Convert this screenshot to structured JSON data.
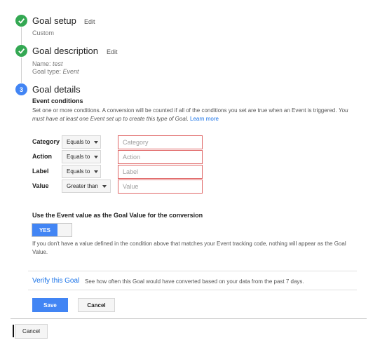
{
  "steps": {
    "setup": {
      "title": "Goal setup",
      "edit": "Edit",
      "value": "Custom"
    },
    "description": {
      "title": "Goal description",
      "edit": "Edit",
      "name_label": "Name:",
      "name_value": "test",
      "type_label": "Goal type:",
      "type_value": "Event"
    },
    "details": {
      "number": "3",
      "title": "Goal details"
    }
  },
  "event_conditions": {
    "heading": "Event conditions",
    "text": "Set one or more conditions. A conversion will be counted if all of the conditions you set are true when an Event is triggered.",
    "text_italic": "You must have at least one Event set up to create this type of Goal.",
    "learn_more": "Learn more",
    "rows": [
      {
        "label": "Category",
        "operator": "Equals to",
        "placeholder": "Category"
      },
      {
        "label": "Action",
        "operator": "Equals to",
        "placeholder": "Action"
      },
      {
        "label": "Label",
        "operator": "Equals to",
        "placeholder": "Label"
      },
      {
        "label": "Value",
        "operator": "Greater than",
        "placeholder": "Value"
      }
    ]
  },
  "goal_value": {
    "heading": "Use the Event value as the Goal Value for the conversion",
    "toggle_label": "YES",
    "toggle_state": "on",
    "note": "If you don't have a value defined in the condition above that matches your Event tracking code, nothing will appear as the Goal Value."
  },
  "verify": {
    "link": "Verify this Goal",
    "text": "See how often this Goal would have converted based on your data from the past 7 days."
  },
  "buttons": {
    "save": "Save",
    "cancel": "Cancel",
    "outer_cancel": "Cancel"
  },
  "colors": {
    "check": "#34a853",
    "accent": "#4285f4",
    "error_border": "#e06666"
  }
}
